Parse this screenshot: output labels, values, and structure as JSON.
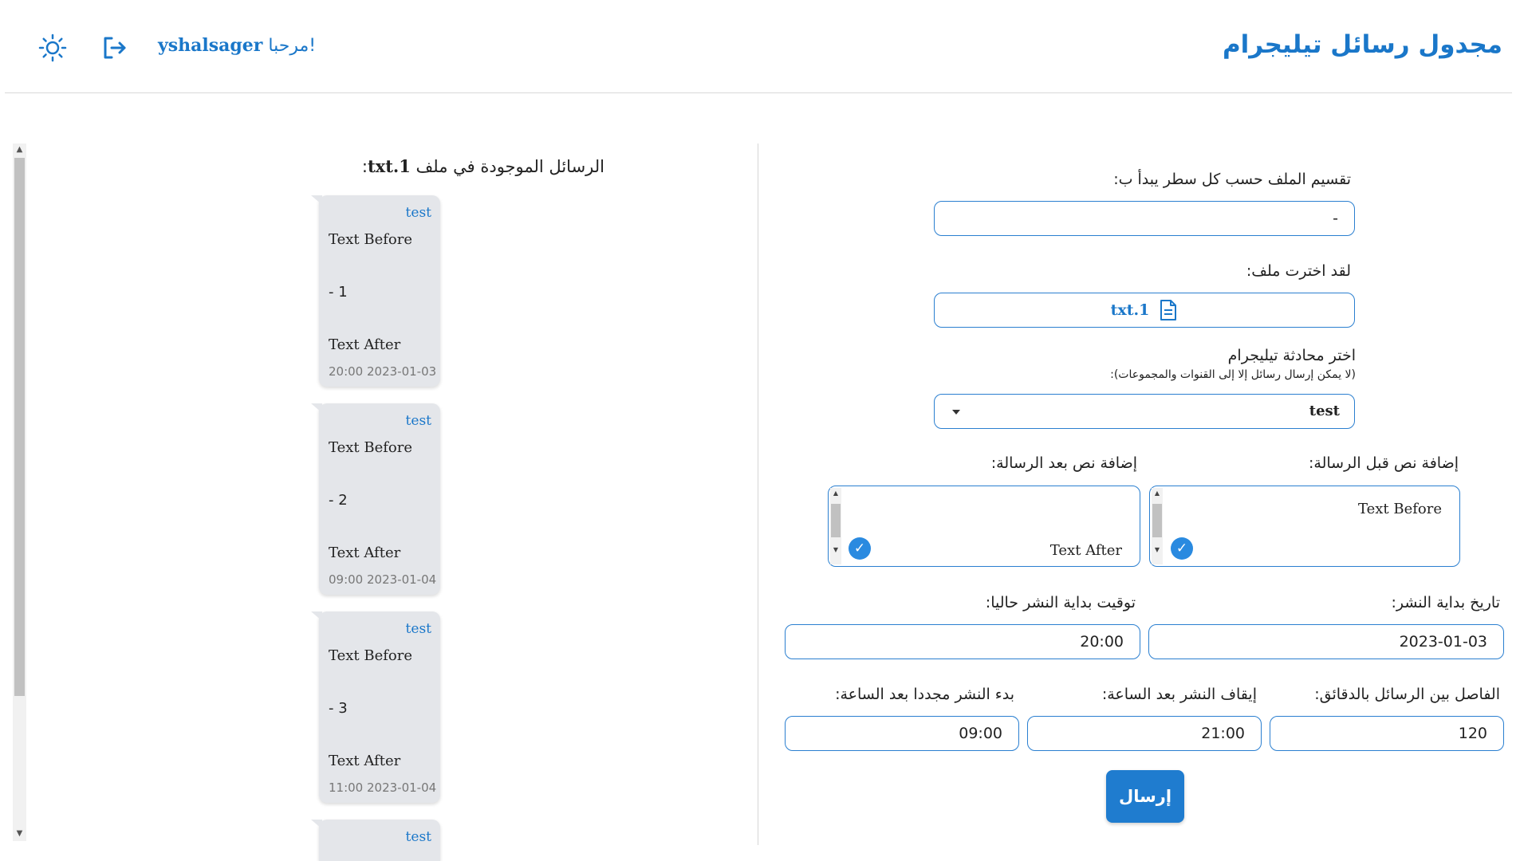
{
  "header": {
    "app_title": "مجدول رسائل تيليجرام",
    "greeting_prefix": "مرحبا!",
    "username": "yshalsager"
  },
  "messages_panel": {
    "title_prefix": "الرسائل الموجودة في ملف",
    "file_label": "txt.1",
    "title_suffix": ":",
    "messages": [
      {
        "chat": "test",
        "before": "Text Before",
        "body": "- 1",
        "after": "Text After",
        "time": "20:00 2023-01-03"
      },
      {
        "chat": "test",
        "before": "Text Before",
        "body": "- 2",
        "after": "Text After",
        "time": "09:00 2023-01-04"
      },
      {
        "chat": "test",
        "before": "Text Before",
        "body": "- 3",
        "after": "Text After",
        "time": "11:00 2023-01-04"
      },
      {
        "chat": "test"
      }
    ]
  },
  "form": {
    "split_label": "تقسيم الملف حسب كل سطر يبدأ ب:",
    "split_value": "-",
    "file_label": "لقد اخترت ملف:",
    "file_name": "txt.1",
    "chat_label": "اختر محادثة تيليجرام",
    "chat_note": "(لا يمكن إرسال رسائل إلا إلى القنوات والمجموعات):",
    "chat_selected": "test",
    "before_label": "إضافة نص قبل الرسالة:",
    "before_value": "Text Before",
    "after_label": "إضافة نص بعد الرسالة:",
    "after_value": "Text After",
    "start_date_label": "تاريخ بداية النشر:",
    "start_date_value": "2023-01-03",
    "start_time_label": "توقيت بداية النشر حاليا:",
    "start_time_value": "20:00",
    "interval_label": "الفاصل بين الرسائل بالدقائق:",
    "interval_value": "120",
    "stop_label": "إيقاف النشر بعد الساعة:",
    "stop_value": "21:00",
    "resume_label": "بدء النشر مجددا بعد الساعة:",
    "resume_value": "09:00",
    "send_label": "إرسال"
  },
  "icons": {
    "theme": "sun-icon",
    "logout": "logout-icon",
    "file": "document-icon",
    "check": "check-icon"
  },
  "colors": {
    "accent": "#1a77c9",
    "bubble": "#e4e6ea",
    "button": "#1f7ccf"
  }
}
